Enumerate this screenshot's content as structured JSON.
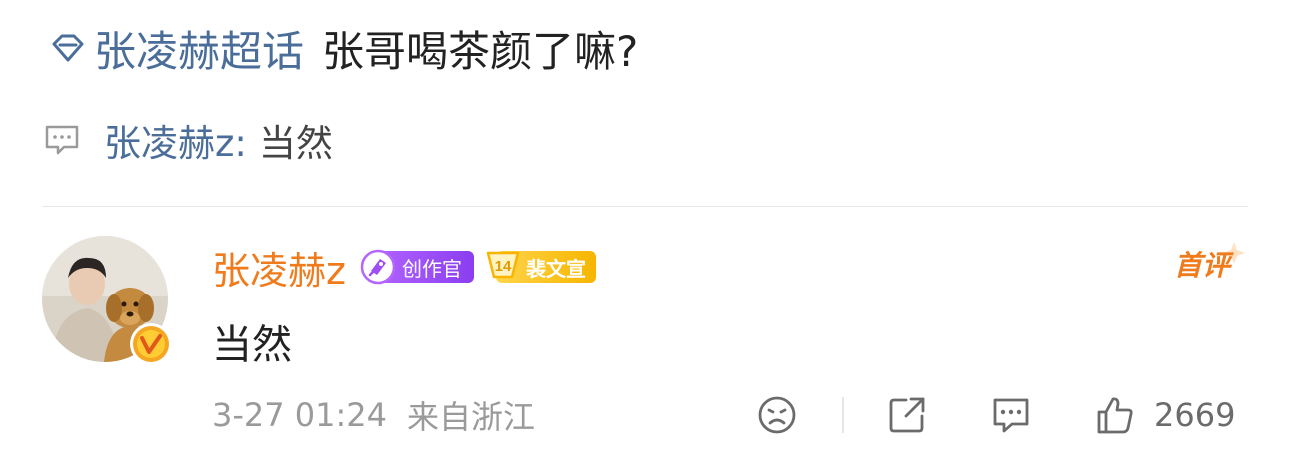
{
  "post": {
    "topic": "张凌赫超话",
    "title": "张哥喝茶颜了嘛?",
    "topic_icon": "supertopic-diamond-icon"
  },
  "quote": {
    "icon": "comment-bubble-icon",
    "author": "张凌赫z:",
    "text": "当然"
  },
  "comment": {
    "username": "张凌赫z",
    "creator_badge": "创作官",
    "fan_badge_level": "14",
    "fan_badge_label": "裴文宣",
    "first_comment_tag": "首评",
    "text": "当然",
    "time": "3-27 01:24",
    "location": "来自浙江",
    "like_count": "2669"
  },
  "colors": {
    "link_blue": "#4a6e99",
    "username_orange": "#f07b1c",
    "creator_purple": "#9d4ef5",
    "fan_gold": "#f7b500",
    "meta_gray": "#9a9a9a"
  },
  "actions": [
    "mood-icon",
    "share-icon",
    "reply-icon",
    "like-icon"
  ]
}
